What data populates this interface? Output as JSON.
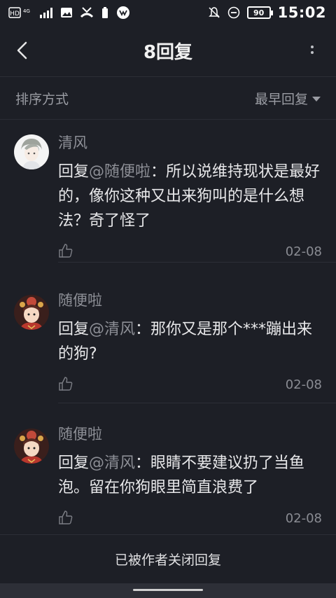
{
  "statusbar": {
    "left_icons": [
      "hd-icon",
      "signal-4g-icon",
      "image-icon",
      "missed-call-icon",
      "battery-saver-icon",
      "app-notification-icon"
    ],
    "hd_label": "HD",
    "net_label": "4G",
    "right_icons": [
      "mute-icon",
      "dnd-icon"
    ],
    "battery": "90",
    "time": "15:02"
  },
  "header": {
    "title": "8回复"
  },
  "sort": {
    "label": "排序方式",
    "selected": "最早回复"
  },
  "comments": [
    {
      "username": "清风",
      "reply_prefix": "回复",
      "mention": "@随便啦",
      "text": "：所以说维持现状是最好的，像你这种又出来狗叫的是什么想法？奇了怪了",
      "date": "02-08"
    },
    {
      "username": "随便啦",
      "reply_prefix": "回复",
      "mention": "@清风",
      "text": "：那你又是那个***蹦出来的狗?",
      "date": "02-08"
    },
    {
      "username": "随便啦",
      "reply_prefix": "回复",
      "mention": "@清风",
      "text": "：眼睛不要建议扔了当鱼泡。留在你狗眼里简直浪费了",
      "date": "02-08"
    }
  ],
  "footer": {
    "text": "已被作者关闭回复"
  },
  "colors": {
    "background": "#1d1f26",
    "muted_text": "#8d8f96",
    "main_text": "#e8e8ea"
  }
}
